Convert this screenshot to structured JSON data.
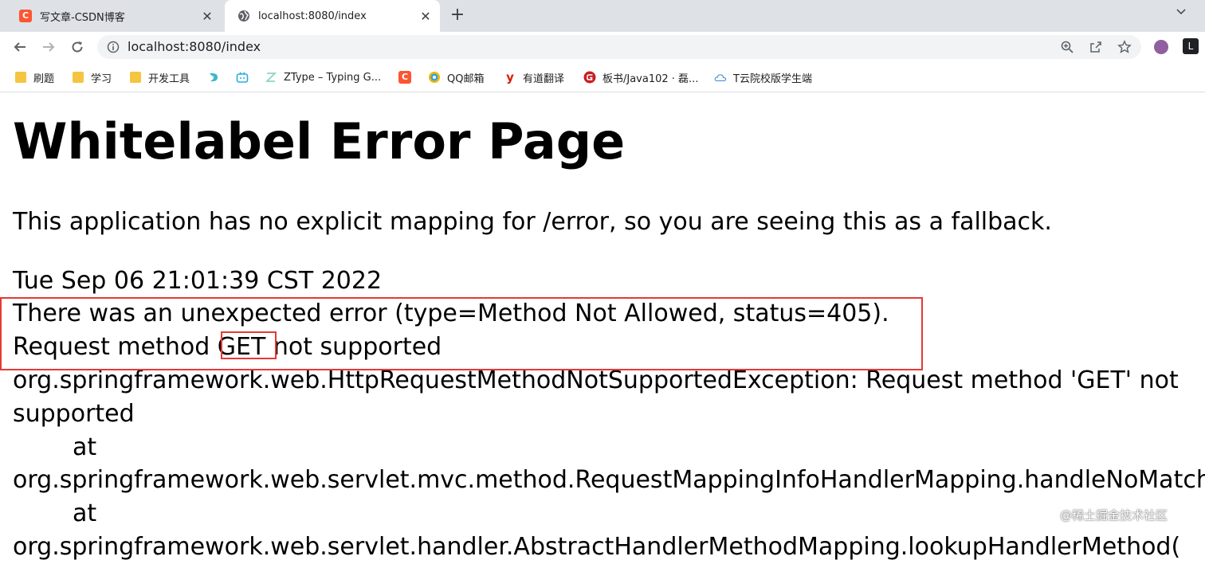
{
  "browser": {
    "tabs": [
      {
        "title": "写文章-CSDN博客",
        "favicon": "csdn-icon",
        "active": false
      },
      {
        "title": "localhost:8080/index",
        "favicon": "globe-icon",
        "active": true
      }
    ],
    "address_bar": {
      "url": "localhost:8080/index"
    },
    "bookmarks": [
      {
        "label": "刷题",
        "icon": "folder-icon"
      },
      {
        "label": "学习",
        "icon": "folder-icon"
      },
      {
        "label": "开发工具",
        "icon": "folder-icon"
      },
      {
        "label": "",
        "icon": "bookmark-site-icon"
      },
      {
        "label": "",
        "icon": "bilibili-icon"
      },
      {
        "label": "ZType – Typing G...",
        "icon": "ztype-icon"
      },
      {
        "label": "",
        "icon": "csdn-icon"
      },
      {
        "label": "QQ邮箱",
        "icon": "qqmail-icon"
      },
      {
        "label": "有道翻译",
        "icon": "youdao-icon"
      },
      {
        "label": "板书/Java102 · 磊...",
        "icon": "gitee-icon"
      },
      {
        "label": "T云院校版学生端",
        "icon": "tcloud-icon"
      }
    ],
    "colors": {
      "tab_strip": "#dee1e6",
      "omnibox": "#f1f3f4",
      "csdn": "#fc5531",
      "highlight": "#e53935"
    }
  },
  "page": {
    "heading": "Whitelabel Error Page",
    "description": "This application has no explicit mapping for /error, so you are seeing this as a fallback.",
    "timestamp": "Tue Sep 06 21:01:39 CST 2022",
    "error_line": "There was an unexpected error (type=Method Not Allowed, status=405).",
    "request_prefix": "Request method ",
    "request_method": "GET",
    "request_suffix": " not supported",
    "trace": [
      "org.springframework.web.HttpRequestMethodNotSupportedException: Request method 'GET' not",
      "supported",
      "at",
      "org.springframework.web.servlet.mvc.method.RequestMappingInfoHandlerMapping.handleNoMatch(",
      "at",
      "org.springframework.web.servlet.handler.AbstractHandlerMethodMapping.lookupHandlerMethod("
    ],
    "watermark": "@稀土掘金技术社区"
  }
}
